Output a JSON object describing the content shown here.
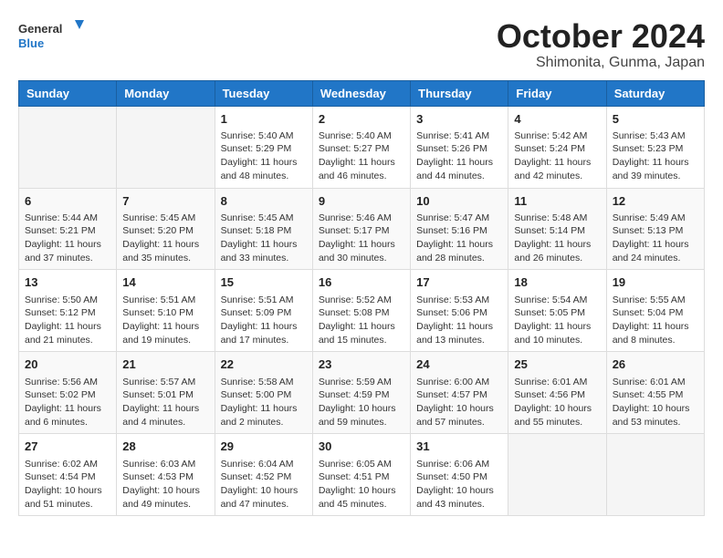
{
  "logo": {
    "general": "General",
    "blue": "Blue"
  },
  "title": "October 2024",
  "subtitle": "Shimonita, Gunma, Japan",
  "headers": [
    "Sunday",
    "Monday",
    "Tuesday",
    "Wednesday",
    "Thursday",
    "Friday",
    "Saturday"
  ],
  "weeks": [
    [
      {
        "day": "",
        "info": ""
      },
      {
        "day": "",
        "info": ""
      },
      {
        "day": "1",
        "sunrise": "Sunrise: 5:40 AM",
        "sunset": "Sunset: 5:29 PM",
        "daylight": "Daylight: 11 hours and 48 minutes."
      },
      {
        "day": "2",
        "sunrise": "Sunrise: 5:40 AM",
        "sunset": "Sunset: 5:27 PM",
        "daylight": "Daylight: 11 hours and 46 minutes."
      },
      {
        "day": "3",
        "sunrise": "Sunrise: 5:41 AM",
        "sunset": "Sunset: 5:26 PM",
        "daylight": "Daylight: 11 hours and 44 minutes."
      },
      {
        "day": "4",
        "sunrise": "Sunrise: 5:42 AM",
        "sunset": "Sunset: 5:24 PM",
        "daylight": "Daylight: 11 hours and 42 minutes."
      },
      {
        "day": "5",
        "sunrise": "Sunrise: 5:43 AM",
        "sunset": "Sunset: 5:23 PM",
        "daylight": "Daylight: 11 hours and 39 minutes."
      }
    ],
    [
      {
        "day": "6",
        "sunrise": "Sunrise: 5:44 AM",
        "sunset": "Sunset: 5:21 PM",
        "daylight": "Daylight: 11 hours and 37 minutes."
      },
      {
        "day": "7",
        "sunrise": "Sunrise: 5:45 AM",
        "sunset": "Sunset: 5:20 PM",
        "daylight": "Daylight: 11 hours and 35 minutes."
      },
      {
        "day": "8",
        "sunrise": "Sunrise: 5:45 AM",
        "sunset": "Sunset: 5:18 PM",
        "daylight": "Daylight: 11 hours and 33 minutes."
      },
      {
        "day": "9",
        "sunrise": "Sunrise: 5:46 AM",
        "sunset": "Sunset: 5:17 PM",
        "daylight": "Daylight: 11 hours and 30 minutes."
      },
      {
        "day": "10",
        "sunrise": "Sunrise: 5:47 AM",
        "sunset": "Sunset: 5:16 PM",
        "daylight": "Daylight: 11 hours and 28 minutes."
      },
      {
        "day": "11",
        "sunrise": "Sunrise: 5:48 AM",
        "sunset": "Sunset: 5:14 PM",
        "daylight": "Daylight: 11 hours and 26 minutes."
      },
      {
        "day": "12",
        "sunrise": "Sunrise: 5:49 AM",
        "sunset": "Sunset: 5:13 PM",
        "daylight": "Daylight: 11 hours and 24 minutes."
      }
    ],
    [
      {
        "day": "13",
        "sunrise": "Sunrise: 5:50 AM",
        "sunset": "Sunset: 5:12 PM",
        "daylight": "Daylight: 11 hours and 21 minutes."
      },
      {
        "day": "14",
        "sunrise": "Sunrise: 5:51 AM",
        "sunset": "Sunset: 5:10 PM",
        "daylight": "Daylight: 11 hours and 19 minutes."
      },
      {
        "day": "15",
        "sunrise": "Sunrise: 5:51 AM",
        "sunset": "Sunset: 5:09 PM",
        "daylight": "Daylight: 11 hours and 17 minutes."
      },
      {
        "day": "16",
        "sunrise": "Sunrise: 5:52 AM",
        "sunset": "Sunset: 5:08 PM",
        "daylight": "Daylight: 11 hours and 15 minutes."
      },
      {
        "day": "17",
        "sunrise": "Sunrise: 5:53 AM",
        "sunset": "Sunset: 5:06 PM",
        "daylight": "Daylight: 11 hours and 13 minutes."
      },
      {
        "day": "18",
        "sunrise": "Sunrise: 5:54 AM",
        "sunset": "Sunset: 5:05 PM",
        "daylight": "Daylight: 11 hours and 10 minutes."
      },
      {
        "day": "19",
        "sunrise": "Sunrise: 5:55 AM",
        "sunset": "Sunset: 5:04 PM",
        "daylight": "Daylight: 11 hours and 8 minutes."
      }
    ],
    [
      {
        "day": "20",
        "sunrise": "Sunrise: 5:56 AM",
        "sunset": "Sunset: 5:02 PM",
        "daylight": "Daylight: 11 hours and 6 minutes."
      },
      {
        "day": "21",
        "sunrise": "Sunrise: 5:57 AM",
        "sunset": "Sunset: 5:01 PM",
        "daylight": "Daylight: 11 hours and 4 minutes."
      },
      {
        "day": "22",
        "sunrise": "Sunrise: 5:58 AM",
        "sunset": "Sunset: 5:00 PM",
        "daylight": "Daylight: 11 hours and 2 minutes."
      },
      {
        "day": "23",
        "sunrise": "Sunrise: 5:59 AM",
        "sunset": "Sunset: 4:59 PM",
        "daylight": "Daylight: 10 hours and 59 minutes."
      },
      {
        "day": "24",
        "sunrise": "Sunrise: 6:00 AM",
        "sunset": "Sunset: 4:57 PM",
        "daylight": "Daylight: 10 hours and 57 minutes."
      },
      {
        "day": "25",
        "sunrise": "Sunrise: 6:01 AM",
        "sunset": "Sunset: 4:56 PM",
        "daylight": "Daylight: 10 hours and 55 minutes."
      },
      {
        "day": "26",
        "sunrise": "Sunrise: 6:01 AM",
        "sunset": "Sunset: 4:55 PM",
        "daylight": "Daylight: 10 hours and 53 minutes."
      }
    ],
    [
      {
        "day": "27",
        "sunrise": "Sunrise: 6:02 AM",
        "sunset": "Sunset: 4:54 PM",
        "daylight": "Daylight: 10 hours and 51 minutes."
      },
      {
        "day": "28",
        "sunrise": "Sunrise: 6:03 AM",
        "sunset": "Sunset: 4:53 PM",
        "daylight": "Daylight: 10 hours and 49 minutes."
      },
      {
        "day": "29",
        "sunrise": "Sunrise: 6:04 AM",
        "sunset": "Sunset: 4:52 PM",
        "daylight": "Daylight: 10 hours and 47 minutes."
      },
      {
        "day": "30",
        "sunrise": "Sunrise: 6:05 AM",
        "sunset": "Sunset: 4:51 PM",
        "daylight": "Daylight: 10 hours and 45 minutes."
      },
      {
        "day": "31",
        "sunrise": "Sunrise: 6:06 AM",
        "sunset": "Sunset: 4:50 PM",
        "daylight": "Daylight: 10 hours and 43 minutes."
      },
      {
        "day": "",
        "info": ""
      },
      {
        "day": "",
        "info": ""
      }
    ]
  ]
}
